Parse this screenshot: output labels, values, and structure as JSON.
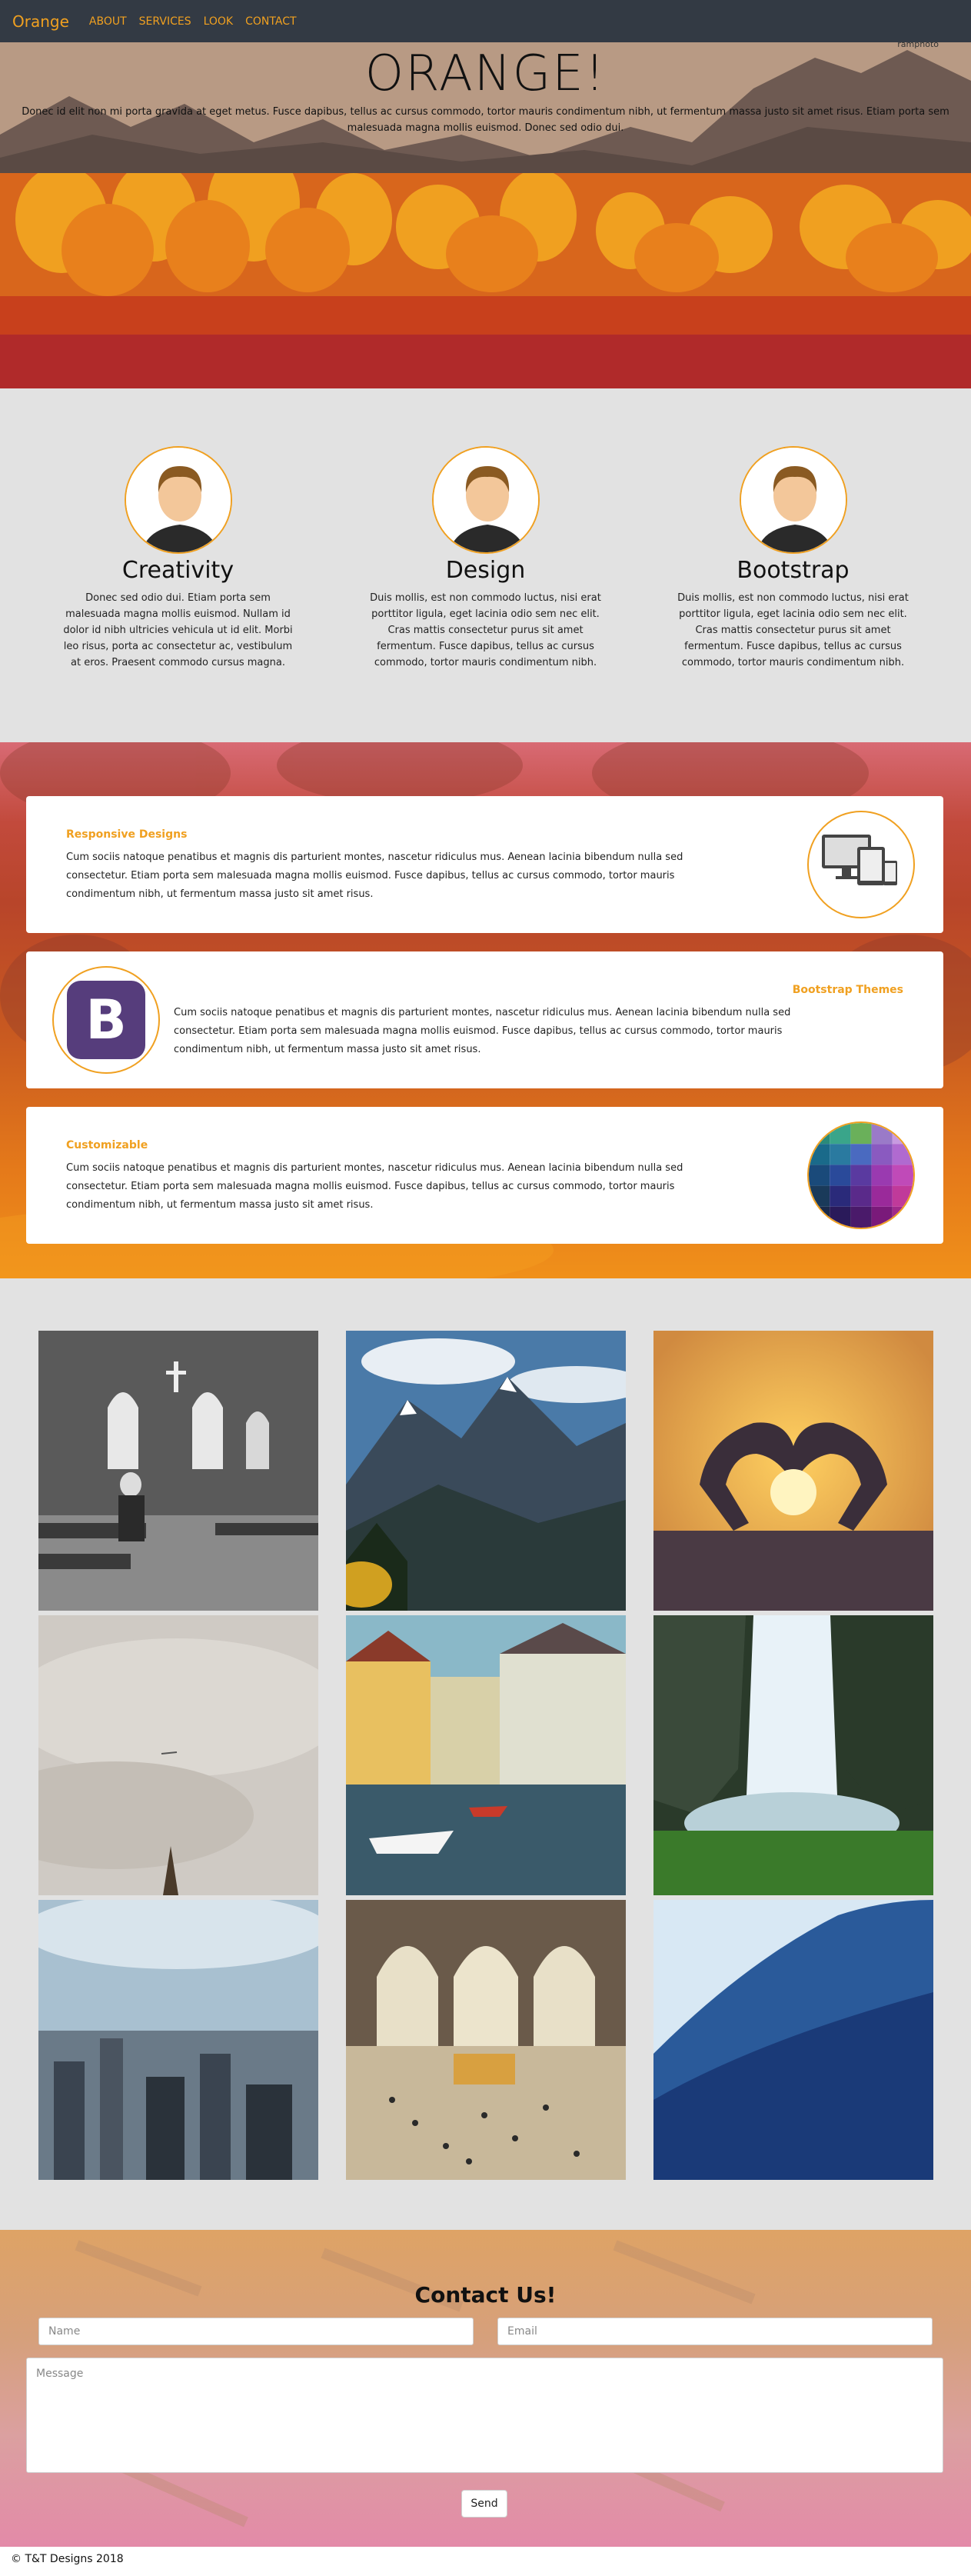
{
  "nav": {
    "brand": "Orange",
    "links": [
      "ABOUT",
      "SERVICES",
      "LOOK",
      "CONTACT"
    ]
  },
  "hero": {
    "title": "ORANGE!",
    "text": "Donec id elit non mi porta gravida at eget metus. Fusce dapibus, tellus ac cursus commodo, tortor mauris condimentum nibh, ut fermentum massa justo sit amet risus. Etiam porta sem malesuada magna mollis euismod. Donec sed odio dui.",
    "corner_text": "ramphoto"
  },
  "features": [
    {
      "icon": "user-avatar-icon",
      "title": "Creativity",
      "text": "Donec sed odio dui. Etiam porta sem malesuada magna mollis euismod. Nullam id dolor id nibh ultricies vehicula ut id elit. Morbi leo risus, porta ac consectetur ac, vestibulum at eros. Praesent commodo cursus magna."
    },
    {
      "icon": "user-avatar-icon",
      "title": "Design",
      "text": "Duis mollis, est non commodo luctus, nisi erat porttitor ligula, eget lacinia odio sem nec elit. Cras mattis consectetur purus sit amet fermentum. Fusce dapibus, tellus ac cursus commodo, tortor mauris condimentum nibh."
    },
    {
      "icon": "user-avatar-icon",
      "title": "Bootstrap",
      "text": "Duis mollis, est non commodo luctus, nisi erat porttitor ligula, eget lacinia odio sem nec elit. Cras mattis consectetur purus sit amet fermentum. Fusce dapibus, tellus ac cursus commodo, tortor mauris condimentum nibh."
    }
  ],
  "cards": [
    {
      "title": "Responsive Designs",
      "icon": "devices-icon",
      "text": "Cum sociis natoque penatibus et magnis dis parturient montes, nascetur ridiculus mus. Aenean lacinia bibendum nulla sed consectetur. Etiam porta sem malesuada magna mollis euismod. Fusce dapibus, tellus ac cursus commodo, tortor mauris condimentum nibh, ut fermentum massa justo sit amet risus."
    },
    {
      "title": "Bootstrap Themes",
      "icon": "bootstrap-logo-icon",
      "logo_letter": "B",
      "text": "Cum sociis natoque penatibus et magnis dis parturient montes, nascetur ridiculus mus. Aenean lacinia bibendum nulla sed consectetur. Etiam porta sem malesuada magna mollis euismod. Fusce dapibus, tellus ac cursus commodo, tortor mauris condimentum nibh, ut fermentum massa justo sit amet risus."
    },
    {
      "title": "Customizable",
      "icon": "color-palette-icon",
      "text": "Cum sociis natoque penatibus et magnis dis parturient montes, nascetur ridiculus mus. Aenean lacinia bibendum nulla sed consectetur. Etiam porta sem malesuada magna mollis euismod. Fusce dapibus, tellus ac cursus commodo, tortor mauris condimentum nibh, ut fermentum massa justo sit amet risus."
    }
  ],
  "gallery": [
    {
      "name": "church-photo"
    },
    {
      "name": "mountain-photo"
    },
    {
      "name": "heart-sunset-photo"
    },
    {
      "name": "cloudy-sky-photo"
    },
    {
      "name": "canal-town-photo"
    },
    {
      "name": "waterfall-photo"
    },
    {
      "name": "city-skyline-photo"
    },
    {
      "name": "train-station-photo"
    },
    {
      "name": "ocean-wave-photo"
    }
  ],
  "contact": {
    "title": "Contact Us!",
    "name_placeholder": "Name",
    "email_placeholder": "Email",
    "message_placeholder": "Message",
    "send_label": "Send"
  },
  "footer": {
    "text": "© T&T Designs 2018"
  },
  "colors": {
    "accent": "#f0a020",
    "navbar": "#333a44",
    "section_bg": "#e2e2e2",
    "bootstrap_purple": "#563d7c"
  }
}
